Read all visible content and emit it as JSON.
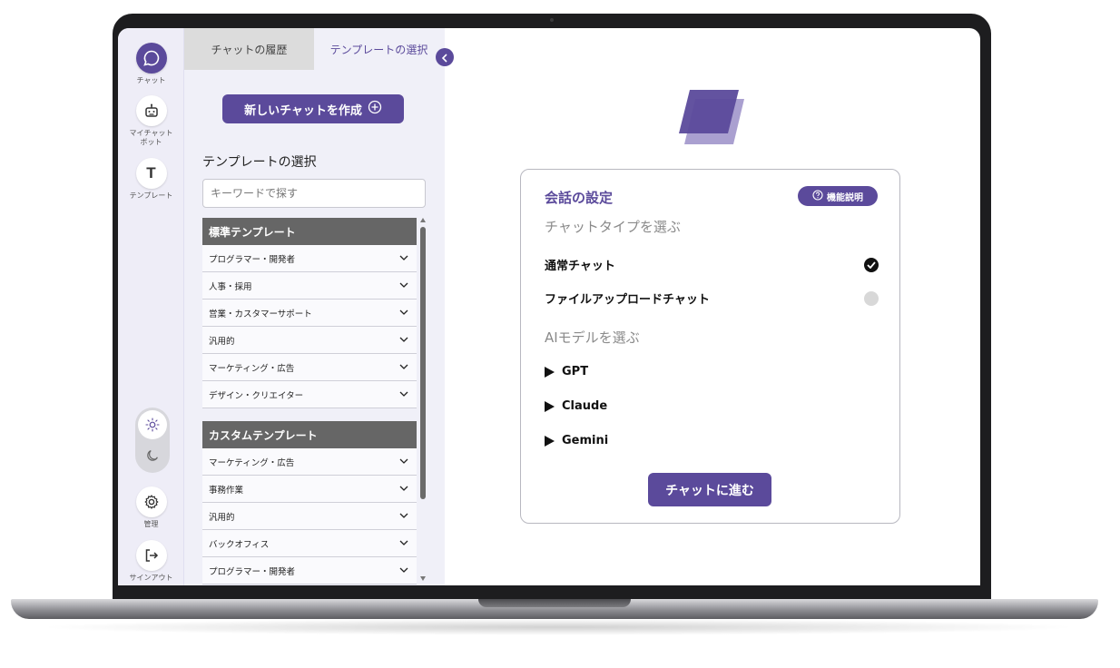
{
  "rail": {
    "chat_label": "チャット",
    "mychatbot_label": "マイチャット\nボット",
    "template_label": "テンプレート",
    "template_letter": "T",
    "admin_label": "管理",
    "signout_label": "サインアウト"
  },
  "panel": {
    "tabs": [
      {
        "label": "チャットの履歴"
      },
      {
        "label": "テンプレートの選択"
      }
    ],
    "new_chat_label": "新しいチャットを作成",
    "heading": "テンプレートの選択",
    "search_placeholder": "キーワードで探す",
    "groups": [
      {
        "title": "標準テンプレート",
        "items": [
          "プログラマー・開発者",
          "人事・採用",
          "営業・カスタマーサポート",
          "汎用的",
          "マーケティング・広告",
          "デザイン・クリエイター"
        ]
      },
      {
        "title": "カスタムテンプレート",
        "items": [
          "マーケティング・広告",
          "事務作業",
          "汎用的",
          "バックオフィス",
          "プログラマー・開発者"
        ]
      }
    ]
  },
  "settings": {
    "title": "会話の設定",
    "help_label": "機能説明",
    "chat_type_heading": "チャットタイプを選ぶ",
    "chat_types": [
      {
        "label": "通常チャット",
        "selected": true
      },
      {
        "label": "ファイルアップロードチャット",
        "selected": false
      }
    ],
    "model_heading": "AIモデルを選ぶ",
    "models": [
      "GPT",
      "Claude",
      "Gemini"
    ],
    "proceed_label": "チャットに進む"
  },
  "colors": {
    "accent": "#5b4a9b",
    "logo_light": "#9b8fc8",
    "logo_dark": "#5b4a9b"
  }
}
